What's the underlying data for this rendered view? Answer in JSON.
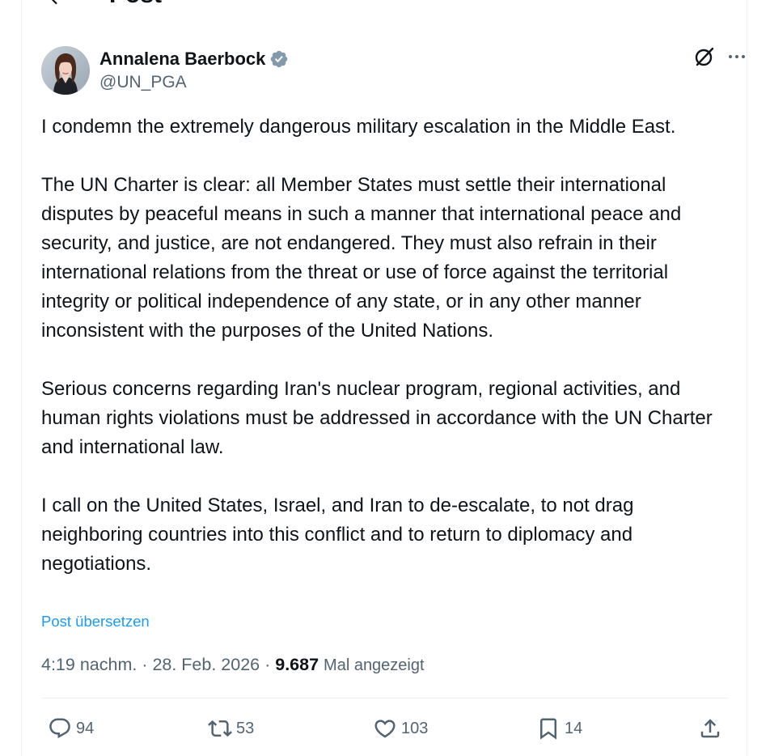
{
  "header": {
    "title": "Post"
  },
  "author": {
    "display_name": "Annalena Baerbock",
    "handle": "@UN_PGA",
    "verified": true
  },
  "tweet": {
    "paragraphs": [
      "I condemn the extremely dangerous military escalation in the Middle East.",
      "The UN Charter is clear: all Member States must settle their international disputes by peaceful means in such a manner that international peace and security, and justice, are not endangered. They must also refrain in their international relations from the threat or use of force against the territorial integrity or political independence of any state, or in any other manner inconsistent with the purposes of the United Nations.",
      "Serious concerns regarding Iran's nuclear program, regional activities, and human rights violations must be addressed in accordance with the UN Charter and international law.",
      "I call on the United States, Israel, and Iran to de-escalate, to not drag neighboring countries into this conflict and to return to diplomacy and negotiations."
    ],
    "translate_label": "Post übersetzen"
  },
  "meta": {
    "time": "4:19 nachm.",
    "separator": " · ",
    "date": "28. Feb. 2026",
    "views_count": "9.687",
    "views_label": "Mal angezeigt"
  },
  "actions": {
    "replies": "94",
    "reposts": "53",
    "likes": "103",
    "bookmarks": "14"
  },
  "colors": {
    "text_primary": "#0f1419",
    "text_secondary": "#536471",
    "link": "#1d9bf0",
    "verified_badge": "#829aab",
    "divider": "#eff3f4"
  },
  "icons": {
    "back": "arrow-left-icon",
    "verified": "verified-badge-icon",
    "grok": "grok-icon",
    "more": "more-dots-icon",
    "reply": "reply-bubble-icon",
    "repost": "repost-arrows-icon",
    "like": "heart-icon",
    "bookmark": "bookmark-icon",
    "share": "share-upload-icon"
  }
}
